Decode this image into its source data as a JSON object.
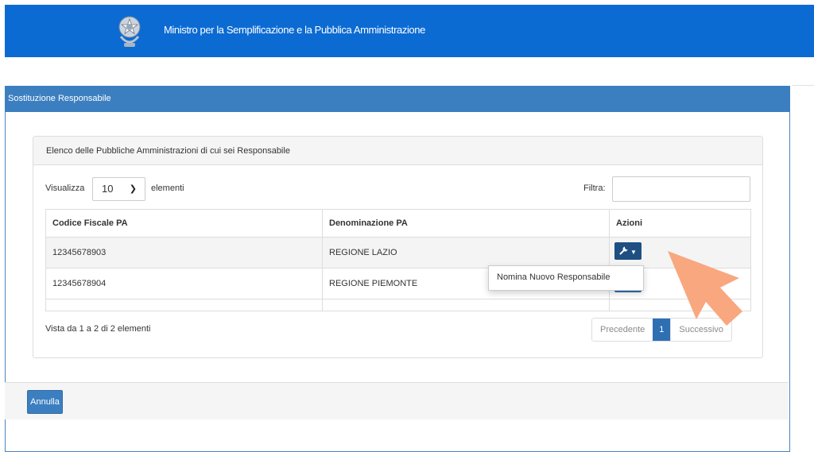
{
  "header": {
    "title": "Ministro per la Semplificazione e la Pubblica Amministrazione",
    "emblem_icon": "italian-republic-emblem",
    "background": "#0c6bd3"
  },
  "panel": {
    "title": "Sostituzione Responsabile"
  },
  "list": {
    "title": "Elenco delle Pubbliche Amministrazioni di cui sei Responsabile",
    "show_label": "Visualizza",
    "page_size": "10",
    "items_label": "elementi",
    "filter_label": "Filtra:",
    "filter_value": "",
    "columns": [
      "Codice Fiscale PA",
      "Denominazione PA",
      "Azioni"
    ],
    "rows": [
      {
        "codice": "12345678903",
        "denominazione": "REGIONE LAZIO"
      },
      {
        "codice": "12345678904",
        "denominazione": "REGIONE PIEMONTE"
      }
    ],
    "actions_icon": "wrench-icon",
    "dropdown_item": "Nomina Nuovo Responsabile",
    "summary": "Vista da 1 a 2 di 2 elementi",
    "pagination": {
      "prev": "Precedente",
      "current": "1",
      "next": "Successivo"
    }
  },
  "footer": {
    "cancel_label": "Annulla"
  },
  "colors": {
    "primary": "#3c7fc0",
    "dark_button": "#1f4f82",
    "highlight_arrow": "#f9a77f"
  }
}
